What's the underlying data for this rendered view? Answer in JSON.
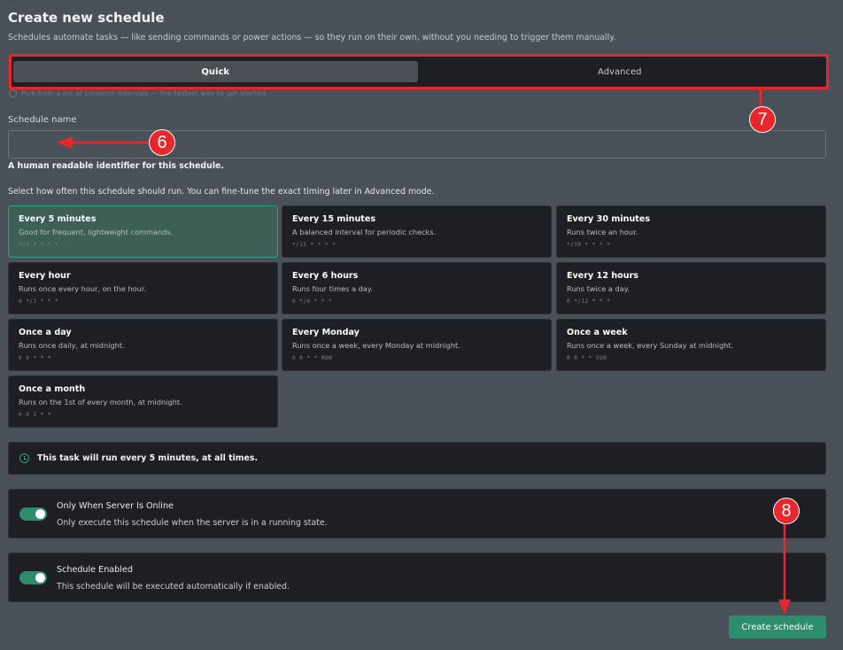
{
  "header": {
    "title": "Create new schedule",
    "subtitle": "Schedules automate tasks — like sending commands or power actions — so they run on their own, without you needing to trigger them manually."
  },
  "mode": {
    "tabs": [
      {
        "label": "Quick",
        "active": true
      },
      {
        "label": "Advanced",
        "active": false
      }
    ],
    "hint": "Pick from a list of common intervals — the fastest way to get started."
  },
  "name_field": {
    "label": "Schedule name",
    "value": "",
    "help": "A human readable identifier for this schedule."
  },
  "frequency": {
    "help": "Select how often this schedule should run. You can fine-tune the exact timing later in Advanced mode.",
    "presets": [
      {
        "title": "Every 5 minutes",
        "desc": "Good for frequent, lightweight commands.",
        "cron": "*/5 * * * *",
        "selected": true
      },
      {
        "title": "Every 15 minutes",
        "desc": "A balanced interval for periodic checks.",
        "cron": "*/15 * * * *",
        "selected": false
      },
      {
        "title": "Every 30 minutes",
        "desc": "Runs twice an hour.",
        "cron": "*/30 * * * *",
        "selected": false
      },
      {
        "title": "Every hour",
        "desc": "Runs once every hour, on the hour.",
        "cron": "0 */1 * * *",
        "selected": false
      },
      {
        "title": "Every 6 hours",
        "desc": "Runs four times a day.",
        "cron": "0 */6 * * *",
        "selected": false
      },
      {
        "title": "Every 12 hours",
        "desc": "Runs twice a day.",
        "cron": "0 */12 * * *",
        "selected": false
      },
      {
        "title": "Once a day",
        "desc": "Runs once daily, at midnight.",
        "cron": "0 0 * * *",
        "selected": false
      },
      {
        "title": "Every Monday",
        "desc": "Runs once a week, every Monday at midnight.",
        "cron": "0 0 * * MON",
        "selected": false
      },
      {
        "title": "Once a week",
        "desc": "Runs once a week, every Sunday at midnight.",
        "cron": "0 0 * * SUN",
        "selected": false
      },
      {
        "title": "Once a month",
        "desc": "Runs on the 1st of every month, at midnight.",
        "cron": "0 0 1 * *",
        "selected": false
      }
    ]
  },
  "summary": {
    "icon": "clock-icon",
    "text": "This task will run every 5 minutes, at all times."
  },
  "toggles": [
    {
      "title": "Only When Server Is Online",
      "desc": "Only execute this schedule when the server is in a running state.",
      "on": true
    },
    {
      "title": "Schedule Enabled",
      "desc": "This schedule will be executed automatically if enabled.",
      "on": true
    }
  ],
  "submit": {
    "label": "Create schedule"
  },
  "annotations": {
    "marker_6": "6",
    "marker_7": "7",
    "marker_8": "8"
  },
  "colors": {
    "accent": "#2d8c6c",
    "annotation": "#e8262b",
    "panel": "#1e1f24",
    "background": "#4a5057"
  }
}
